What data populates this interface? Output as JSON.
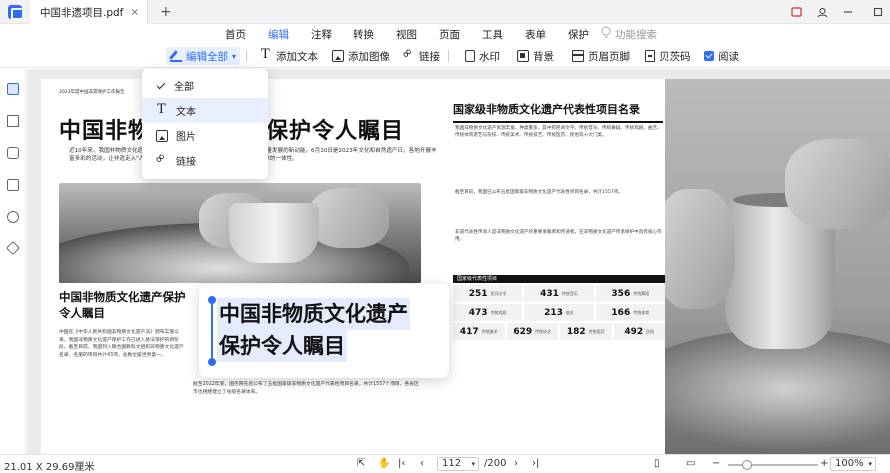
{
  "titlebar": {
    "tab_title": "中国非遗项目.pdf",
    "close_glyph": "×",
    "new_tab_glyph": "+"
  },
  "menu": {
    "items": [
      "首页",
      "编辑",
      "注释",
      "转换",
      "视图",
      "页面",
      "工具",
      "表单",
      "保护"
    ],
    "active": "编辑",
    "search_hint": "功能搜索"
  },
  "toolbar": {
    "edit_all": "编辑全部",
    "add_text": "添加文本",
    "add_image": "添加图像",
    "link": "链接",
    "watermark": "水印",
    "background": "背景",
    "header_footer": "页眉页脚",
    "bates": "贝茨码",
    "read": "阅读"
  },
  "dropdown": {
    "items": [
      {
        "label": "全部",
        "checked": true
      },
      {
        "label": "文本",
        "checked": false
      },
      {
        "label": "图片",
        "checked": false
      },
      {
        "label": "链接",
        "checked": false
      }
    ]
  },
  "document": {
    "header_small": "2023年度中国非遗保护工作报告",
    "main_title": "中国非物质文化遗产保护令人瞩目",
    "intro": "近10年来，我国非物质文化遗产保护工作取得显著成效，成为推动经济社会高质量发展的新动能。6月10日是2023年文化和自然遗产日，各地开展丰富多彩的活动，让非遗走入\"人民的生活，人民共享\"，实现了非遗保护及文化传承的一体性。",
    "section_title": "中国非物质文化遗产保护令人瞩目",
    "floating_text_line1": "中国非物质文化遗产",
    "floating_text_line2": "保护令人瞩目",
    "right_title": "国家级非物质文化遗产代表性项目名录",
    "table_title": "国家级代表性项目",
    "stats": [
      [
        {
          "num": "251",
          "lbl": "民间文学"
        },
        {
          "num": "431",
          "lbl": "传统音乐"
        },
        {
          "num": "356",
          "lbl": "传统舞蹈"
        }
      ],
      [
        {
          "num": "473",
          "lbl": "传统戏剧"
        },
        {
          "num": "213",
          "lbl": "曲艺"
        },
        {
          "num": "166",
          "lbl": "传统体育"
        }
      ],
      [
        {
          "num": "417",
          "lbl": "传统美术"
        },
        {
          "num": "629",
          "lbl": "传统技艺"
        },
        {
          "num": "182",
          "lbl": "传统医药"
        },
        {
          "num": "492",
          "lbl": "民俗"
        }
      ]
    ],
    "col_text_left": "中国在《中华人民共和国非物质文化遗产法》颁布实施以来，我国非物质文化遗产保护工作已进入依法保护的新阶段。截至目前，我国列入联合国教科文组织非物质文化遗产名录、名册的项目共计43项，总数位居世界第一。",
    "col_text_mid": "截至2022年底，国务院先后公布了五批国家级非物质文化遗产代表性项目名录，共计1557个项目。各省区市也相继建立了省级名录体系。",
    "rt_text_1": "我国非物质文化遗产资源丰富、种类繁多，其中有民间文学、传统音乐、传统舞蹈、传统戏剧、曲艺、传统体育游艺与杂技、传统美术、传统技艺、传统医药、民俗等十大门类。",
    "rt_text_2": "截至目前，我国已公布五批国家级非物质文化遗产代表性项目名录，共计1557项。",
    "rt_text_3": "非遗代表性传承人是非物质文化遗产的重要承载者和传递者，在非物质文化遗产传承保护中具有核心作用。"
  },
  "status": {
    "page_size": "21.01 X 29.69厘米",
    "current_page": "112",
    "total_pages": "/200",
    "zoom": "100%"
  }
}
